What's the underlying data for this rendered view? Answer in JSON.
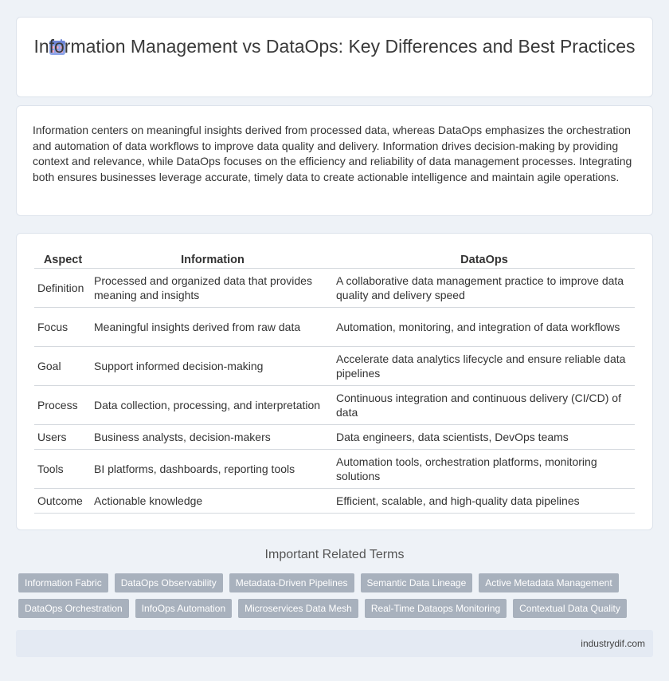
{
  "header": {
    "title": "Information Management vs DataOps: Key Differences and Best Practices",
    "icon": "calendar-grid-icon"
  },
  "intro": {
    "text": "Information centers on meaningful insights derived from processed data, whereas DataOps emphasizes the orchestration and automation of data workflows to improve data quality and delivery. Information drives decision-making by providing context and relevance, while DataOps focuses on the efficiency and reliability of data management processes. Integrating both ensures businesses leverage accurate, timely data to create actionable intelligence and maintain agile operations."
  },
  "table": {
    "headers": [
      "Aspect",
      "Information",
      "DataOps"
    ],
    "rows": [
      [
        "Definition",
        "Processed and organized data that provides meaning and insights",
        "A collaborative data management practice to improve data quality and delivery speed"
      ],
      [
        "Focus",
        "Meaningful insights derived from raw data",
        "Automation, monitoring, and integration of data workflows"
      ],
      [
        "Goal",
        "Support informed decision-making",
        "Accelerate data analytics lifecycle and ensure reliable data pipelines"
      ],
      [
        "Process",
        "Data collection, processing, and interpretation",
        "Continuous integration and continuous delivery (CI/CD) of data"
      ],
      [
        "Users",
        "Business analysts, decision-makers",
        "Data engineers, data scientists, DevOps teams"
      ],
      [
        "Tools",
        "BI platforms, dashboards, reporting tools",
        "Automation tools, orchestration platforms, monitoring solutions"
      ],
      [
        "Outcome",
        "Actionable knowledge",
        "Efficient, scalable, and high-quality data pipelines"
      ]
    ]
  },
  "related": {
    "title": "Important Related Terms",
    "row1": [
      "Information Fabric",
      "DataOps Observability",
      "Metadata-Driven Pipelines",
      "Semantic Data Lineage",
      "Active Metadata Management"
    ],
    "row2": [
      "DataOps Orchestration",
      "InfoOps Automation",
      "Microservices Data Mesh",
      "Real-Time Dataops Monitoring",
      "Contextual Data Quality"
    ]
  },
  "footer": {
    "site": "industrydif.com"
  },
  "colors": {
    "background": "#eef2f7",
    "tag": "#a8b1bd",
    "footer": "#e4eaf3"
  }
}
